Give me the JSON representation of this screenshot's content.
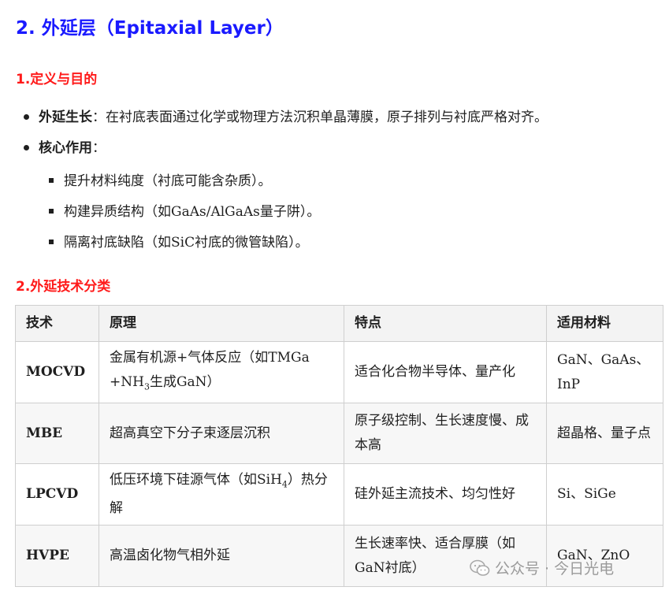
{
  "heading": "2. 外延层（Epitaxial Layer）",
  "section1": {
    "title": "1.定义与目的",
    "bullets": [
      {
        "term": "外延生长",
        "sep": "：",
        "text": "在衬底表面通过化学或物理方法沉积单晶薄膜，原子排列与衬底严格对齐。"
      },
      {
        "term": "核心作用",
        "sep": "：",
        "text": ""
      }
    ],
    "sub_bullets": [
      "提升材料纯度（衬底可能含杂质）。",
      "构建异质结构（如GaAs/AlGaAs量子阱）。",
      "隔离衬底缺陷（如SiC衬底的微管缺陷）。"
    ]
  },
  "section2": {
    "title": "2.外延技术分类",
    "table": {
      "headers": [
        "技术",
        "原理",
        "特点",
        "适用材料"
      ],
      "rows": [
        {
          "tech": "MOCVD",
          "principle_pre": "金属有机源+气体反应（如TMGa +NH",
          "principle_sub": "3",
          "principle_post": "生成GaN）",
          "feature": "适合化合物半导体、量产化",
          "material": "GaN、GaAs、InP"
        },
        {
          "tech": "MBE",
          "principle_pre": "超高真空下分子束逐层沉积",
          "principle_sub": "",
          "principle_post": "",
          "feature": "原子级控制、生长速度慢、成本高",
          "material": "超晶格、量子点"
        },
        {
          "tech": "LPCVD",
          "principle_pre": "低压环境下硅源气体（如SiH",
          "principle_sub": "4",
          "principle_post": "）热分解",
          "feature": "硅外延主流技术、均匀性好",
          "material": "Si、SiGe"
        },
        {
          "tech": "HVPE",
          "principle_pre": "高温卤化物气相外延",
          "principle_sub": "",
          "principle_post": "",
          "feature": "生长速率快、适合厚膜（如GaN衬底）",
          "material": "GaN、ZnO"
        }
      ]
    }
  },
  "watermark": "公众号 · 今日光电",
  "colors": {
    "heading": "#1a1aff",
    "section_title": "#ff1a1a",
    "table_header_bg": "#f3f3f3",
    "border": "#cfcfcf"
  }
}
